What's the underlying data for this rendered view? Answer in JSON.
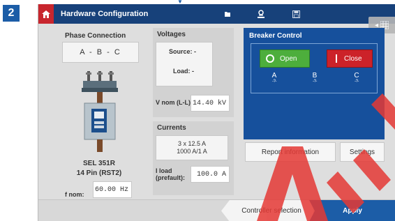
{
  "step": "2",
  "colors": {
    "accent": "#1c5da7",
    "open": "#4dae3c",
    "close": "#cc2229",
    "watermark": "#e53935"
  },
  "header": {
    "title": "Hardware Configuration",
    "icons": [
      "home-icon",
      "folder-icon",
      "user-icon",
      "save-icon"
    ]
  },
  "phase": {
    "title": "Phase Connection",
    "value": "A - B - C",
    "relay_name": "SEL 351R",
    "relay_pin": "14 Pin (RST2)",
    "fnom_label": "f nom:",
    "fnom_value": "60.00 Hz"
  },
  "voltages": {
    "title": "Voltages",
    "source": "Source: -",
    "load": "Load: -",
    "vnom_label": "V nom (L-L):",
    "vnom_value": "14.40 kV"
  },
  "currents": {
    "title": "Currents",
    "line1": "3 x 12.5 A",
    "line2": "1000 A/1 A",
    "iload_label_1": "I load",
    "iload_label_2": "(prefault):",
    "iload_value": "100.0 A"
  },
  "breaker": {
    "title": "Breaker Control",
    "open_label": "Open",
    "close_label": "Close",
    "phases": [
      {
        "label": "A",
        "state": "-?-"
      },
      {
        "label": "B",
        "state": "-?-"
      },
      {
        "label": "C",
        "state": "-?-"
      }
    ]
  },
  "buttons": {
    "report": "Report information",
    "settings": "Settings"
  },
  "footer": {
    "controller_selection": "Controller selection",
    "apply": "Apply"
  }
}
